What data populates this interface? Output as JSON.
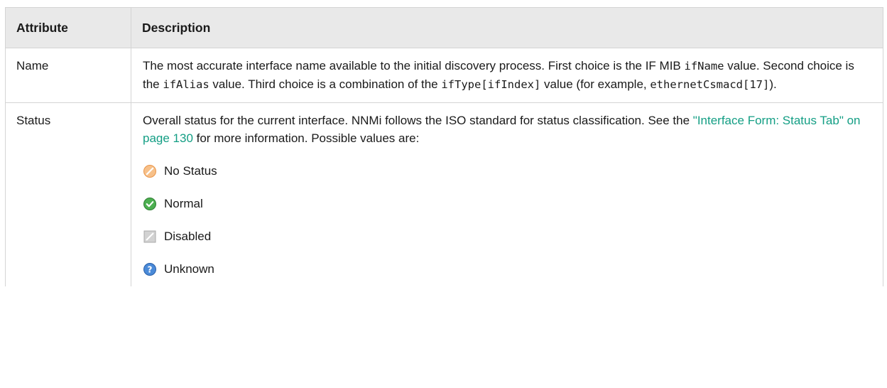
{
  "table": {
    "headers": {
      "attribute": "Attribute",
      "description": "Description"
    },
    "rows": {
      "name": {
        "attribute": "Name",
        "desc": {
          "t1": "The most accurate interface name available to the initial discovery process. First choice is the IF MIB ",
          "c1": "ifName",
          "t2": " value. Second choice is the ",
          "c2": "ifAlias",
          "t3": " value. Third choice is a combination of the ",
          "c3": "ifType[ifIndex]",
          "t4": " value (for example, ",
          "c4": "ethernetCsmacd[17]",
          "t5": ")."
        }
      },
      "status": {
        "attribute": "Status",
        "desc": {
          "t1": "Overall status for the current interface. NNMi follows the ISO standard for status classification. See the ",
          "link": "\"Interface Form: Status Tab\" on page 130",
          "t2": " for more information. Possible values are:"
        },
        "values": [
          {
            "label": "No Status",
            "icon": "no-status-icon"
          },
          {
            "label": "Normal",
            "icon": "normal-status-icon"
          },
          {
            "label": "Disabled",
            "icon": "disabled-status-icon"
          },
          {
            "label": "Unknown",
            "icon": "unknown-status-icon"
          }
        ]
      }
    }
  },
  "colors": {
    "header_bg": "#e9e9e9",
    "border": "#d4d4d4",
    "link": "#139e84",
    "no_status": "#f0a35a",
    "normal": "#4caf50",
    "disabled": "#b8b8b8",
    "unknown": "#3f7fd0"
  }
}
